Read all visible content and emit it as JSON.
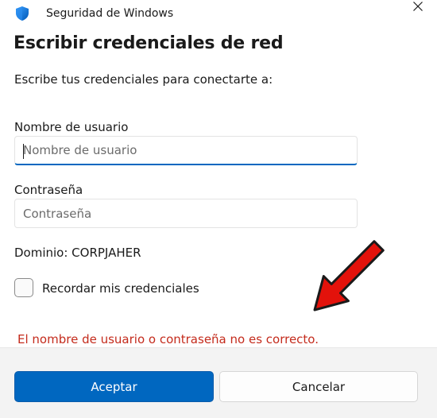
{
  "window": {
    "app_title": "Seguridad de Windows",
    "close_icon": "close-icon"
  },
  "dialog": {
    "heading": "Escribir credenciales de red",
    "subtitle": "Escribe tus credenciales para conectarte a:",
    "username": {
      "label": "Nombre de usuario",
      "placeholder": "Nombre de usuario",
      "value": ""
    },
    "password": {
      "label": "Contraseña",
      "placeholder": "Contraseña",
      "value": ""
    },
    "domain": "Dominio: CORPJAHER",
    "remember": {
      "label": "Recordar mis credenciales",
      "checked": false
    },
    "error": "El nombre de usuario o contraseña no es correcto."
  },
  "buttons": {
    "accept": "Aceptar",
    "cancel": "Cancelar"
  },
  "colors": {
    "accent": "#0067c0",
    "error": "#c42b1c",
    "annotation_arrow": "#e3120b"
  }
}
